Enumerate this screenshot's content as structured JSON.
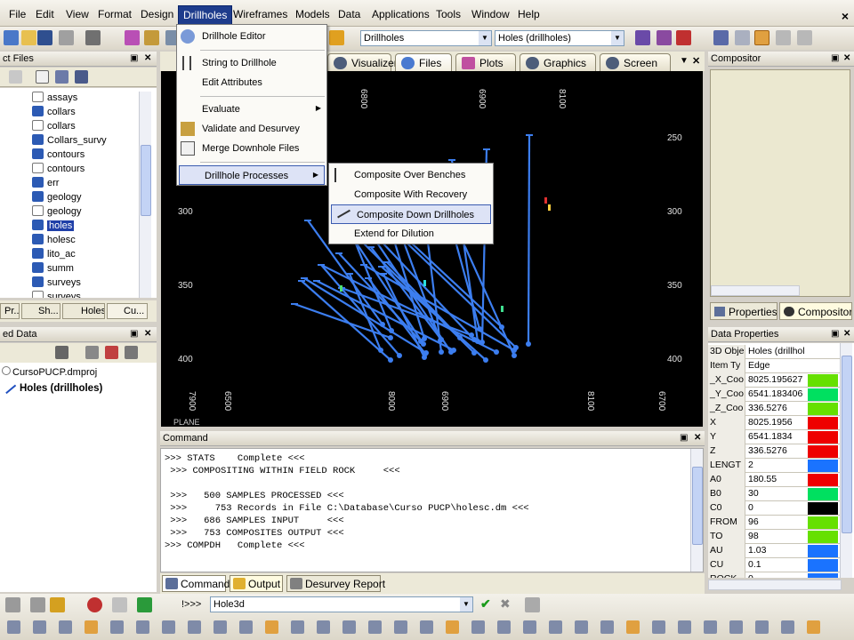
{
  "menubar": {
    "items": [
      "File",
      "Edit",
      "View",
      "Format",
      "Design",
      "Drillholes",
      "Wireframes",
      "Models",
      "Data",
      "Applications",
      "Tools",
      "Window",
      "Help"
    ],
    "active_index": 5,
    "close_glyph": "×"
  },
  "toolbar": {
    "combo1": {
      "value": "Drillholes"
    },
    "combo2": {
      "value": "Holes (drillholes)"
    }
  },
  "left_panel": {
    "title": "ct Files",
    "tree_items": [
      {
        "label": "assays",
        "icon": "table-icon"
      },
      {
        "label": "collars",
        "icon": "drillhole-icon"
      },
      {
        "label": "collars",
        "icon": "table-icon"
      },
      {
        "label": "Collars_survy",
        "icon": "drillhole-icon"
      },
      {
        "label": "contours",
        "icon": "drillhole-icon"
      },
      {
        "label": "contours",
        "icon": "table-icon"
      },
      {
        "label": "err",
        "icon": "drillhole-icon"
      },
      {
        "label": "geology",
        "icon": "drillhole-icon"
      },
      {
        "label": "geology",
        "icon": "table-icon"
      },
      {
        "label": "holes",
        "icon": "drillhole-icon",
        "selected": true
      },
      {
        "label": "holesc",
        "icon": "drillhole-icon"
      },
      {
        "label": "lito_ac",
        "icon": "drillhole-icon"
      },
      {
        "label": "summ",
        "icon": "drillhole-icon"
      },
      {
        "label": "surveys",
        "icon": "drillhole-icon"
      },
      {
        "label": "surveys",
        "icon": "table-icon"
      }
    ],
    "tabs": [
      "Pr...",
      "Sh...",
      "Holes",
      "Cu..."
    ]
  },
  "loaded_data": {
    "title": "ed Data",
    "items": [
      {
        "label": "CursoPUCP.dmproj"
      },
      {
        "label": "Holes (drillholes)"
      }
    ]
  },
  "view_tabs": [
    "Visualizer",
    "Files",
    "Plots",
    "Graphics",
    "Screen"
  ],
  "viewport": {
    "top_labels": [
      "6800",
      "6900",
      "8100"
    ],
    "bottom_labels": [
      "7900",
      "6500",
      "8000",
      "6900",
      "8100",
      "6700"
    ],
    "left_labels": [
      "300",
      "350",
      "400"
    ],
    "right_labels": [
      "250",
      "300",
      "350",
      "400"
    ],
    "corner_label": "PLANE"
  },
  "drillholes_menu": {
    "items": [
      {
        "label": "Drillhole Editor"
      },
      {
        "label": "String to Drillhole"
      },
      {
        "label": "Edit Attributes"
      },
      {
        "label": "Evaluate",
        "submenu": true
      },
      {
        "label": "Validate and Desurvey"
      },
      {
        "label": "Merge Downhole Files"
      },
      {
        "label": "Drillhole Processes",
        "submenu": true,
        "highlighted": true
      }
    ],
    "submenu_items": [
      {
        "label": "Composite Over Benches"
      },
      {
        "label": "Composite With Recovery"
      },
      {
        "label": "Composite Down Drillholes",
        "highlighted": true
      },
      {
        "label": "Extend for Dilution"
      }
    ],
    "arrow_glyph": "▶"
  },
  "command_panel": {
    "title": "Command",
    "lines": [
      ">>> STATS    Complete <<<",
      " >>> COMPOSITING WITHIN FIELD ROCK     <<<",
      "",
      " >>>   500 SAMPLES PROCESSED <<<",
      " >>>     753 Records in File C:\\Database\\Curso PUCP\\holesc.dm <<<",
      " >>>   686 SAMPLES INPUT     <<<",
      " >>>   753 COMPOSITES OUTPUT <<<",
      ">>> COMPDH   Complete <<<"
    ],
    "tabs": [
      "Command",
      "Output",
      "Desurvey Report"
    ]
  },
  "bottom_toolbar": {
    "command_field": "Hole3d",
    "prompt": "!>>>"
  },
  "compositor": {
    "title": "Compositor",
    "tabs": [
      "Properties",
      "Compositor"
    ]
  },
  "data_properties": {
    "title": "Data Properties",
    "rows": [
      {
        "key": "3D Obje",
        "value": "Holes (drillhol",
        "color": "#ffffff"
      },
      {
        "key": "Item Ty",
        "value": "Edge",
        "color": "#ffffff"
      },
      {
        "key": "_X_Coo",
        "value": "8025.195627",
        "color": "#66e000"
      },
      {
        "key": "_Y_Coo",
        "value": "6541.183406",
        "color": "#00e060"
      },
      {
        "key": "_Z_Coo",
        "value": "336.5276",
        "color": "#66e000"
      },
      {
        "key": "X",
        "value": "8025.1956",
        "color": "#ee0000"
      },
      {
        "key": "Y",
        "value": "6541.1834",
        "color": "#ee0000"
      },
      {
        "key": "Z",
        "value": "336.5276",
        "color": "#ee0000"
      },
      {
        "key": "LENGT",
        "value": "2",
        "color": "#1a73ff"
      },
      {
        "key": "A0",
        "value": "180.55",
        "color": "#ee0000"
      },
      {
        "key": "B0",
        "value": "30",
        "color": "#00e060"
      },
      {
        "key": "C0",
        "value": "0",
        "color": "#000000"
      },
      {
        "key": "FROM",
        "value": "96",
        "color": "#66e000"
      },
      {
        "key": "TO",
        "value": "98",
        "color": "#66e000"
      },
      {
        "key": "AU",
        "value": "1.03",
        "color": "#1a73ff"
      },
      {
        "key": "CU",
        "value": "0.1",
        "color": "#1a73ff"
      },
      {
        "key": "ROCK",
        "value": "0",
        "color": "#1a73ff"
      }
    ]
  }
}
